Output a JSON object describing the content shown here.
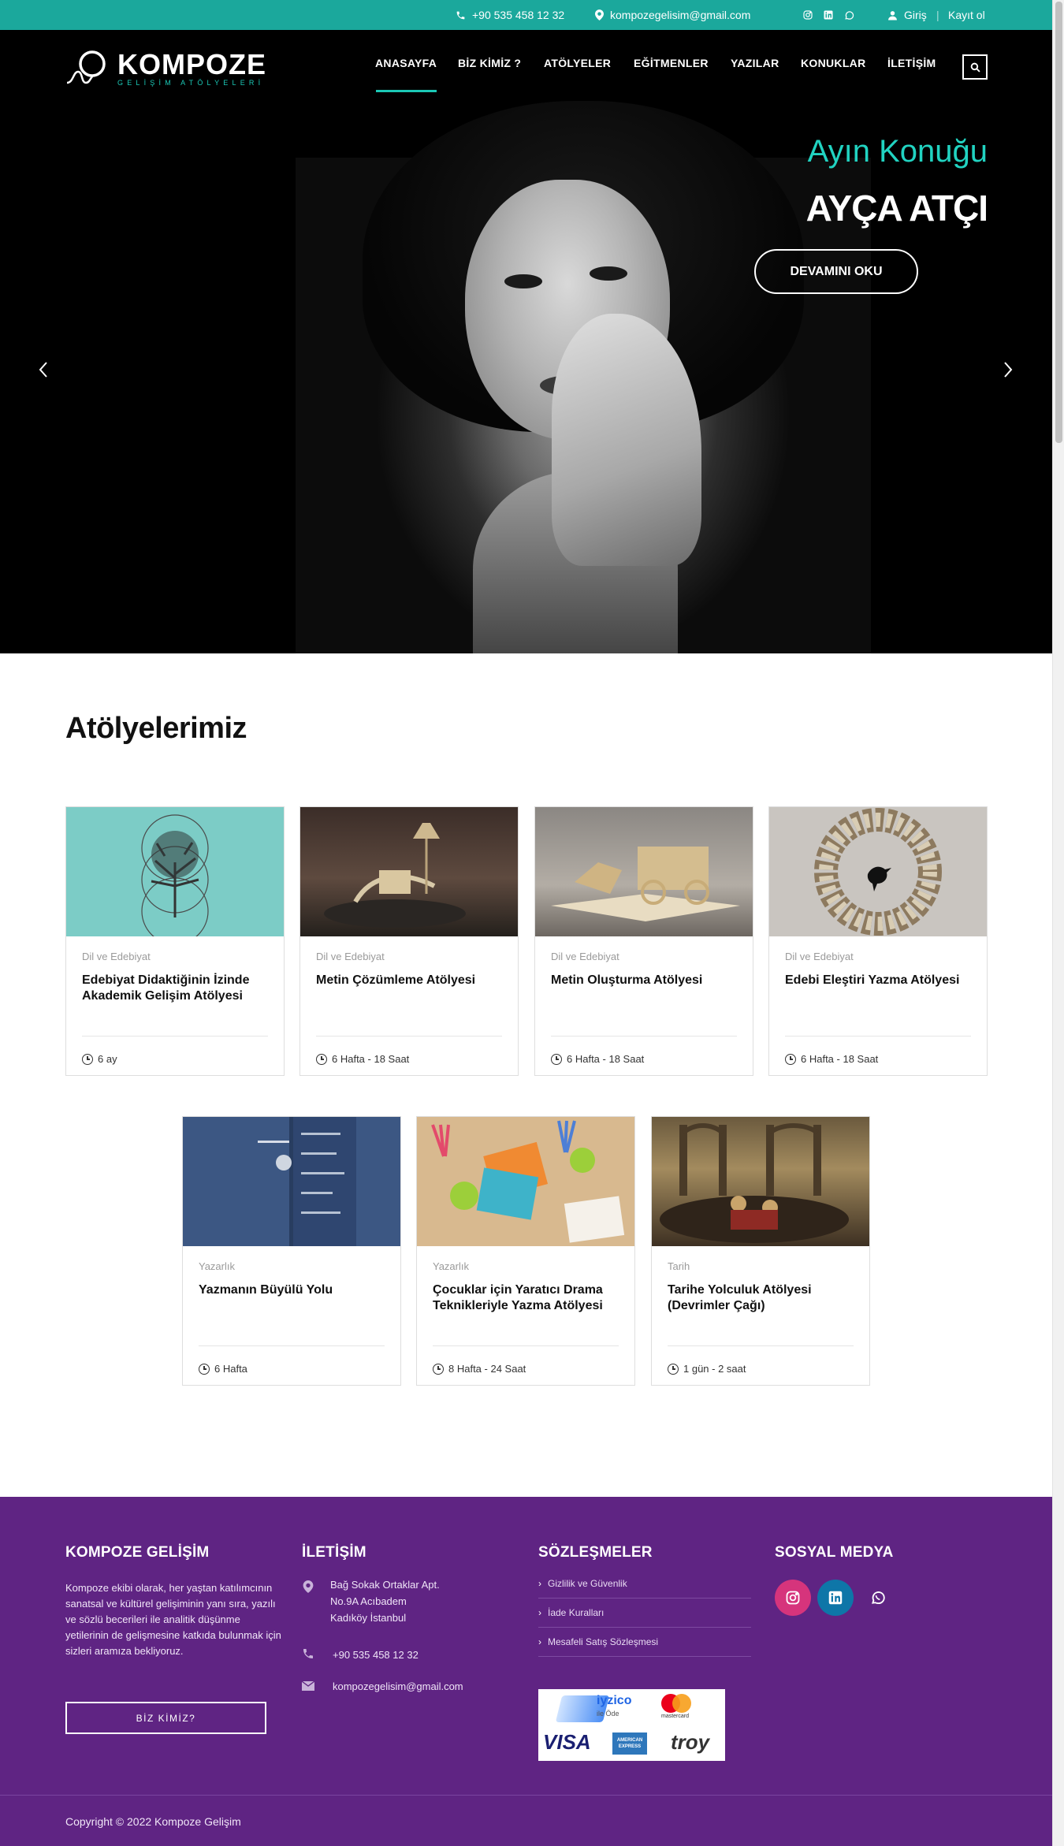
{
  "topbar": {
    "phone": "+90 535 458 12 32",
    "email": "kompozegelisim@gmail.com",
    "social_icons": [
      "instagram-icon",
      "linkedin-icon",
      "whatsapp-icon"
    ],
    "login": "Giriş",
    "separator": "|",
    "register": "Kayıt ol"
  },
  "brand": {
    "name": "KOMPOZE",
    "tagline": "GELİŞİM ATÖLYELERİ"
  },
  "nav": {
    "items": [
      "ANASAYFA",
      "BİZ KİMİZ ?",
      "ATÖLYELER",
      "EĞİTMENLER",
      "YAZILAR",
      "KONUKLAR",
      "İLETİŞİM"
    ],
    "active": "ANASAYFA"
  },
  "hero": {
    "kicker": "Ayın Konuğu",
    "title": "AYÇA ATÇI",
    "button": "DEVAMINI OKU"
  },
  "workshops": {
    "title": "Atölyelerimiz",
    "cards": [
      {
        "category": "Dil ve Edebiyat",
        "title": "Edebiyat Didaktiğinin İzinde Akademik Gelişim Atölyesi",
        "duration": "6 ay"
      },
      {
        "category": "Dil ve Edebiyat",
        "title": "Metin Çözümleme Atölyesi",
        "duration": "6 Hafta - 18 Saat"
      },
      {
        "category": "Dil ve Edebiyat",
        "title": "Metin Oluşturma Atölyesi",
        "duration": "6 Hafta - 18 Saat"
      },
      {
        "category": "Dil ve Edebiyat",
        "title": "Edebi Eleştiri Yazma Atölyesi",
        "duration": "6 Hafta - 18 Saat"
      },
      {
        "category": "Yazarlık",
        "title": "Yazmanın Büyülü Yolu",
        "duration": "6 Hafta"
      },
      {
        "category": "Yazarlık",
        "title": "Çocuklar için Yaratıcı Drama Teknikleriyle Yazma Atölyesi",
        "duration": "8 Hafta - 24 Saat"
      },
      {
        "category": "Tarih",
        "title": "Tarihe Yolculuk Atölyesi (Devrimler Çağı)",
        "duration": "1 gün - 2 saat"
      }
    ]
  },
  "footer": {
    "about_title": "KOMPOZE GELİŞİM",
    "about_text": "Kompoze ekibi olarak, her yaştan katılımcının sanatsal ve kültürel gelişiminin yanı sıra, yazılı ve sözlü becerileri ile analitik düşünme yetilerinin de gelişmesine katkıda bulunmak için sizleri aramıza bekliyoruz.",
    "about_button": "BİZ KİMİZ?",
    "contact_title": "İLETİŞİM",
    "address_lines": [
      "Bağ Sokak Ortaklar Apt.",
      "No.9A Acıbadem",
      "Kadıköy İstanbul"
    ],
    "phone": "+90 535 458 12 32",
    "email": "kompozegelisim@gmail.com",
    "contracts_title": "SÖZLEŞMELER",
    "contracts": [
      "Gizlilik ve Güvenlik",
      "İade Kuralları",
      "Mesafeli Satış Sözleşmesi"
    ],
    "payment": {
      "iyzico": "iyzico",
      "iyzico_sub": "ile Öde",
      "mastercard": "mastercard",
      "visa": "VISA",
      "amex": "AMERICAN EXPRESS",
      "troy": "troy"
    },
    "social_title": "SOSYAL MEDYA",
    "social_icons": [
      "instagram-icon",
      "linkedin-icon",
      "whatsapp-icon"
    ],
    "copyright": "Copyright © 2022 Kompoze Gelişim"
  },
  "colors": {
    "accent": "#1ba89c",
    "accent_light": "#21d3c1",
    "footer_bg": "#5f2483",
    "instagram": "#d6347c",
    "linkedin": "#0e76a8"
  }
}
